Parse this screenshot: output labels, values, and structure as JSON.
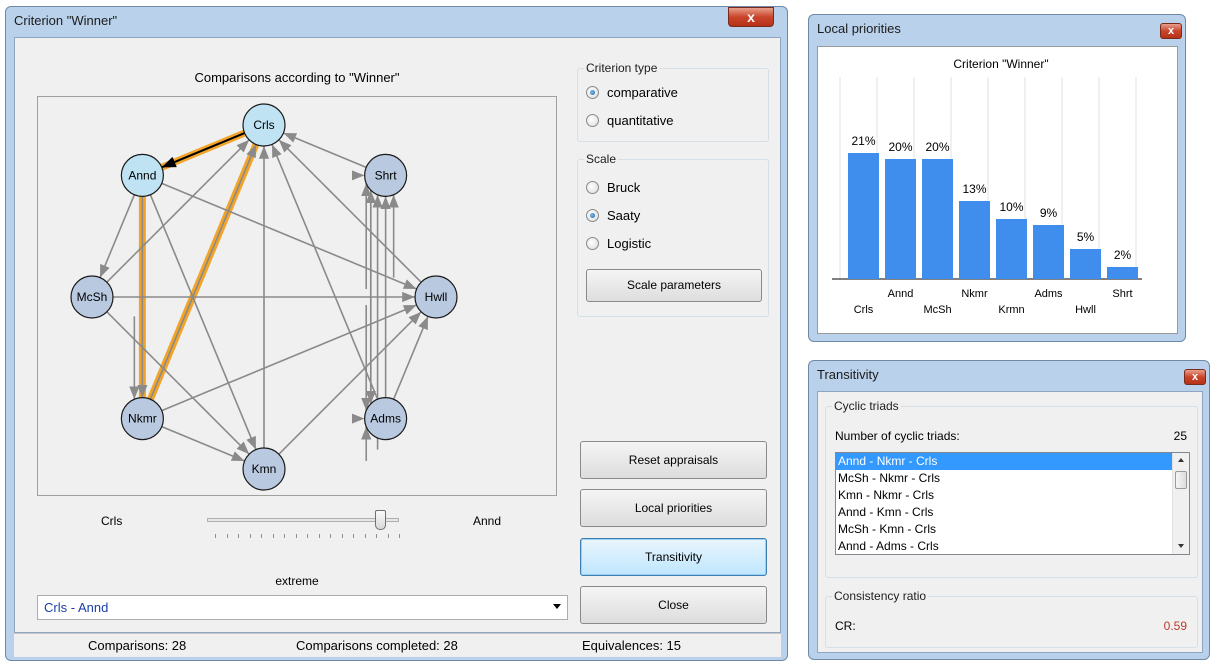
{
  "criterion_window": {
    "title": "Criterion \"Winner\"",
    "close_glyph": "x",
    "graph_title": "Comparisons according to \"Winner\"",
    "nodes": [
      {
        "id": "crls",
        "label": "Crls"
      },
      {
        "id": "shrt",
        "label": "Shrt"
      },
      {
        "id": "hwll",
        "label": "Hwll"
      },
      {
        "id": "adms",
        "label": "Adms"
      },
      {
        "id": "kmn",
        "label": "Kmn"
      },
      {
        "id": "nkmr",
        "label": "Nkmr"
      },
      {
        "id": "mcsh",
        "label": "McSh"
      },
      {
        "id": "annd",
        "label": "Annd"
      }
    ],
    "criterion_type": {
      "title": "Criterion type",
      "options": [
        {
          "label": "comparative",
          "selected": true
        },
        {
          "label": "quantitative",
          "selected": false
        }
      ]
    },
    "scale": {
      "title": "Scale",
      "options": [
        {
          "label": "Bruck",
          "selected": false
        },
        {
          "label": "Saaty",
          "selected": true
        },
        {
          "label": "Logistic",
          "selected": false
        }
      ],
      "params_button": "Scale parameters"
    },
    "slider": {
      "left_label": "Crls",
      "right_label": "Annd",
      "value_label": "extreme",
      "position": 0.9
    },
    "pair_select": {
      "value": "Crls - Annd"
    },
    "buttons": {
      "reset": "Reset appraisals",
      "local": "Local priorities",
      "transitivity": "Transitivity",
      "close": "Close"
    },
    "status": {
      "comparisons": "Comparisons: 28",
      "completed": "Comparisons completed: 28",
      "equivalences": "Equivalences: 15"
    }
  },
  "local_priorities_window": {
    "title": "Local priorities",
    "close_glyph": "x",
    "chart_data": {
      "type": "bar",
      "title": "Criterion \"Winner\"",
      "categories": [
        "Crls",
        "Annd",
        "McSh",
        "Nkmr",
        "Krmn",
        "Adms",
        "Hwll",
        "Shrt"
      ],
      "values": [
        21,
        20,
        20,
        13,
        10,
        9,
        5,
        2
      ],
      "value_labels": [
        "21%",
        "20%",
        "20%",
        "13%",
        "10%",
        "9%",
        "5%",
        "2%"
      ],
      "ylim": [
        0,
        25
      ],
      "bar_color": "#3f8ded",
      "grid": true
    }
  },
  "transitivity_window": {
    "title": "Transitivity",
    "close_glyph": "x",
    "cyclic": {
      "title": "Cyclic triads",
      "count_label": "Number of cyclic triads:",
      "count_value": "25",
      "items": [
        "Annd - Nkmr - Crls",
        "McSh - Nkmr - Crls",
        "Kmn - Nkmr - Crls",
        "Annd - Kmn - Crls",
        "McSh - Kmn - Crls",
        "Annd - Adms - Crls"
      ]
    },
    "consistency": {
      "title": "Consistency ratio",
      "label": "CR:",
      "value": "0.59",
      "value_color": "#c0392b"
    }
  }
}
